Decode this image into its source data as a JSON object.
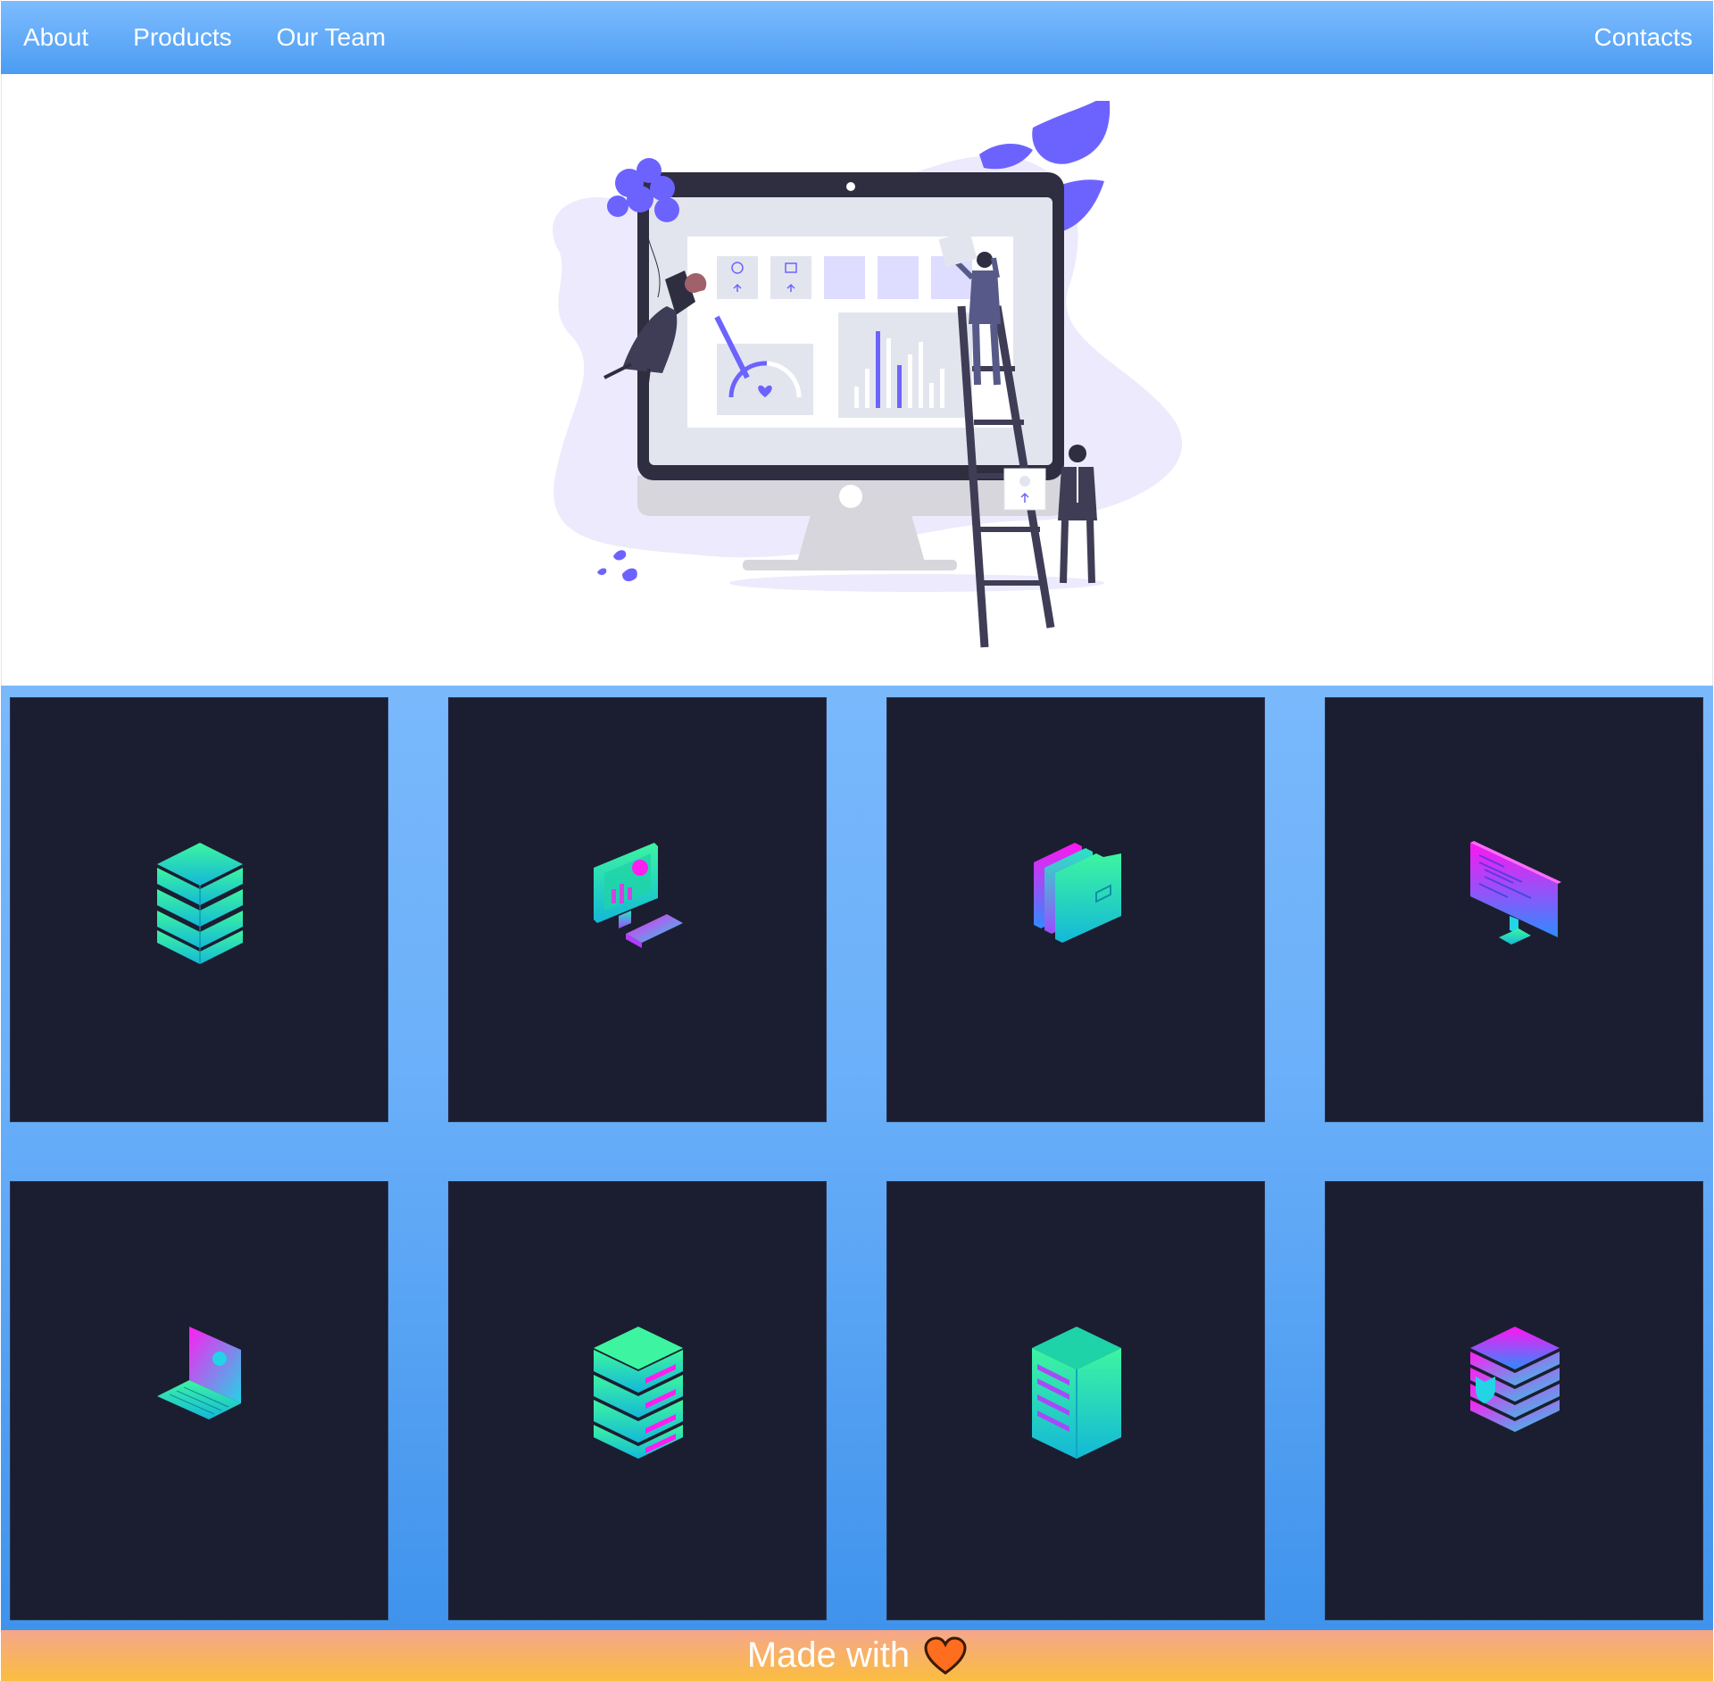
{
  "nav": {
    "items": [
      {
        "label": "About"
      },
      {
        "label": "Products"
      },
      {
        "label": "Our Team"
      }
    ],
    "contacts_label": "Contacts"
  },
  "hero": {
    "illustration": "dashboard-team-illustration"
  },
  "products": {
    "tiles": [
      {
        "icon": "database-stack-icon"
      },
      {
        "icon": "analytics-desktop-icon"
      },
      {
        "icon": "folders-icon"
      },
      {
        "icon": "code-monitor-icon"
      },
      {
        "icon": "laptop-settings-icon"
      },
      {
        "icon": "server-rack-icon"
      },
      {
        "icon": "server-tower-icon"
      },
      {
        "icon": "secure-database-icon"
      }
    ]
  },
  "footer": {
    "text": "Made with",
    "icon": "heart-icon"
  },
  "colors": {
    "nav_top": "#7dbcff",
    "nav_bottom": "#4b9cf2",
    "tile_bg": "#1b1e30",
    "accent_purple": "#6c63ff",
    "gradient_cyan": "#1de9b6",
    "gradient_magenta": "#ff00ff",
    "footer_top": "#f5a68c",
    "footer_bottom": "#fbbd3f"
  }
}
